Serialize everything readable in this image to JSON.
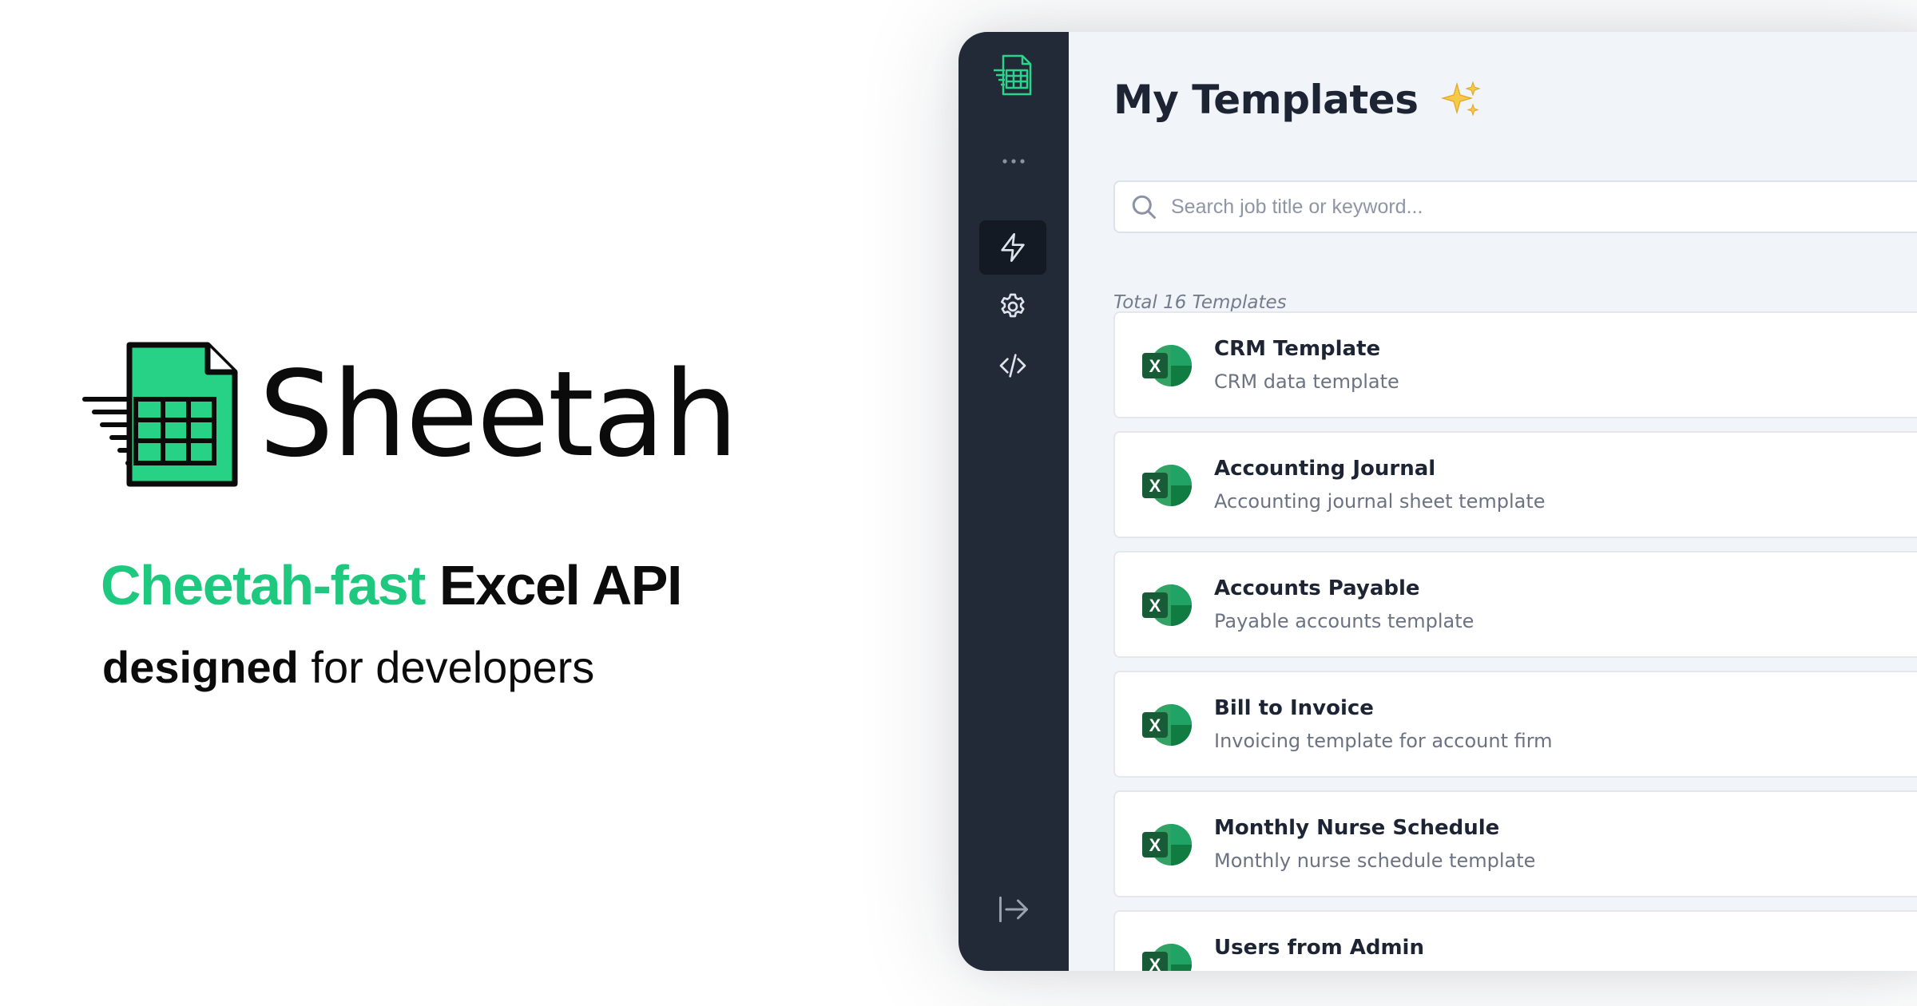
{
  "brand": {
    "name": "Sheetah",
    "tagline_accent": "Cheetah-fast",
    "tagline_rest": "Excel API",
    "subtitle_strong": "designed",
    "subtitle_rest": "for developers",
    "accent_color": "#1ec97f"
  },
  "sidebar": {
    "logo": "spreadsheet-logo-icon",
    "more": "more-dots-icon",
    "items": [
      {
        "icon": "lightning-icon",
        "active": true
      },
      {
        "icon": "gear-icon",
        "active": false
      },
      {
        "icon": "code-icon",
        "active": false
      }
    ],
    "footer_icon": "collapse-arrow-icon",
    "bg_color": "#222a37"
  },
  "main": {
    "title": "My Templates",
    "title_emoji": "sparkles-icon",
    "search_placeholder": "Search job title or keyword...",
    "total_text": "Total 16 Templates",
    "templates": [
      {
        "title": "CRM Template",
        "description": "CRM data template"
      },
      {
        "title": "Accounting Journal",
        "description": "Accounting journal sheet template"
      },
      {
        "title": "Accounts Payable",
        "description": "Payable accounts template"
      },
      {
        "title": "Bill to Invoice",
        "description": "Invoicing template for account firm"
      },
      {
        "title": "Monthly Nurse Schedule",
        "description": "Monthly nurse schedule template"
      },
      {
        "title": "Users from Admin",
        "description": ""
      }
    ],
    "excel_color": "#1d6f42"
  }
}
